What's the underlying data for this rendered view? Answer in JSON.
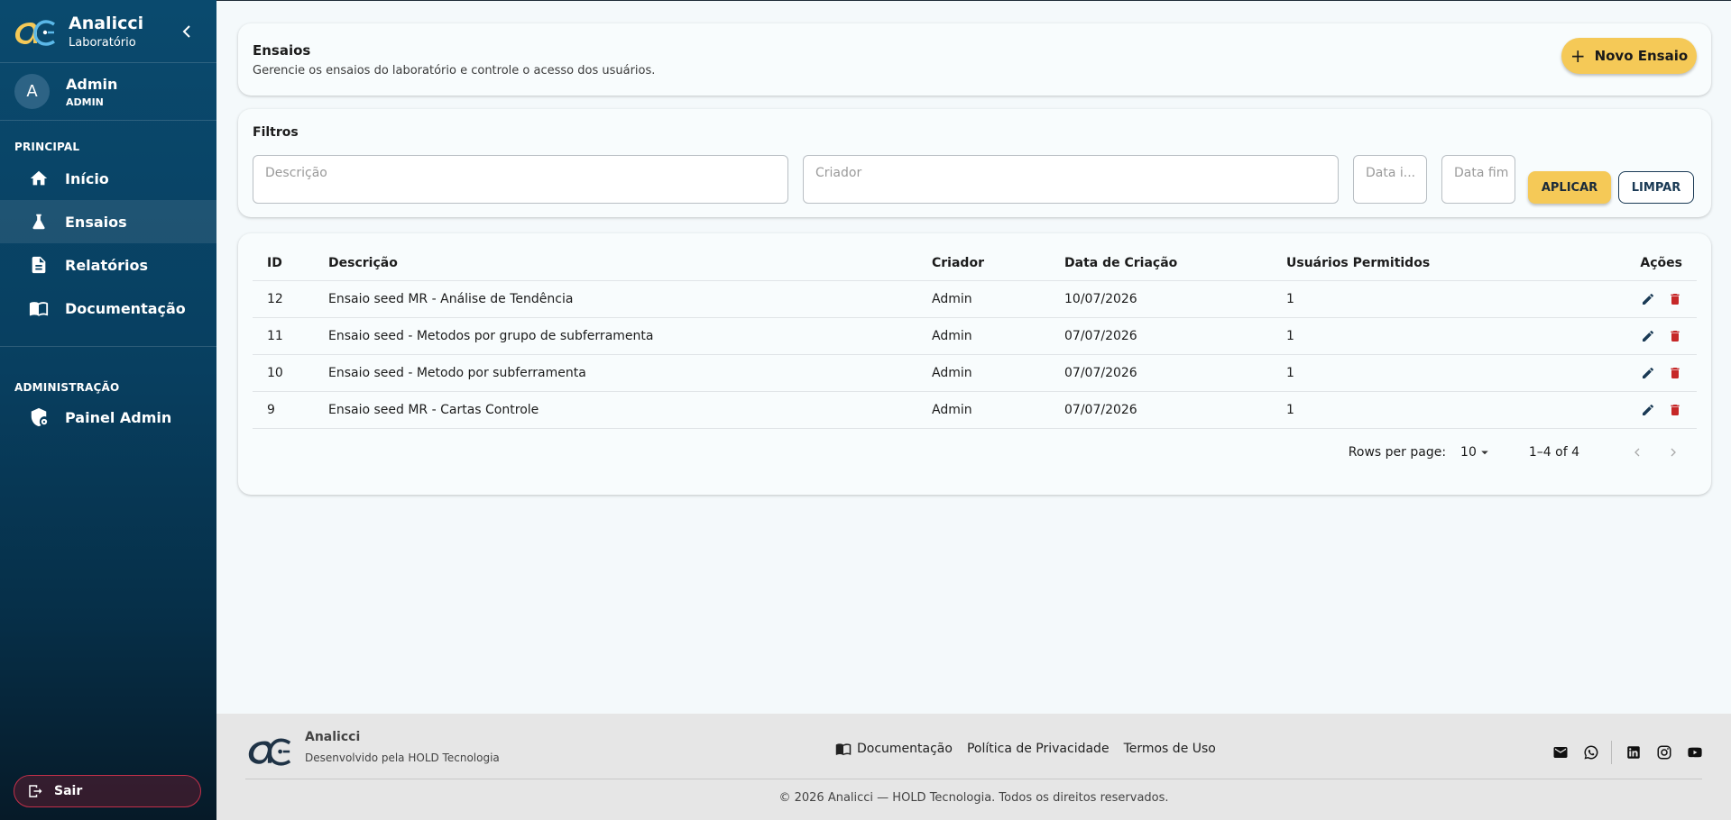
{
  "brand": {
    "name": "Analicci",
    "subtitle": "Laboratório"
  },
  "user": {
    "initial": "A",
    "name": "Admin",
    "role": "ADMIN"
  },
  "sidebar": {
    "sections": [
      {
        "label": "PRINCIPAL"
      },
      {
        "label": "ADMINISTRAÇÃO"
      }
    ],
    "items": [
      {
        "label": "Início",
        "icon": "home-icon"
      },
      {
        "label": "Ensaios",
        "icon": "flask-icon",
        "active": true
      },
      {
        "label": "Relatórios",
        "icon": "document-icon"
      },
      {
        "label": "Documentação",
        "icon": "book-icon"
      },
      {
        "label": "Painel Admin",
        "icon": "shield-gear-icon"
      }
    ],
    "logout": "Sair"
  },
  "header": {
    "title": "Ensaios",
    "subtitle": "Gerencie os ensaios do laboratório e controle o acesso dos usuários.",
    "new_button": "Novo Ensaio"
  },
  "filters": {
    "title": "Filtros",
    "descricao_placeholder": "Descrição",
    "criador_placeholder": "Criador",
    "data_inicio_placeholder": "Data i...",
    "data_fim_placeholder": "Data fim",
    "apply": "APLICAR",
    "clear": "LIMPAR"
  },
  "table": {
    "columns": [
      "ID",
      "Descrição",
      "Criador",
      "Data de Criação",
      "Usuários Permitidos",
      "Ações"
    ],
    "rows": [
      {
        "id": "12",
        "descricao": "Ensaio seed MR - Análise de Tendência",
        "criador": "Admin",
        "data": "10/07/2026",
        "usuarios": "1"
      },
      {
        "id": "11",
        "descricao": "Ensaio seed - Metodos por grupo de subferramenta",
        "criador": "Admin",
        "data": "07/07/2026",
        "usuarios": "1"
      },
      {
        "id": "10",
        "descricao": "Ensaio seed - Metodo por subferramenta",
        "criador": "Admin",
        "data": "07/07/2026",
        "usuarios": "1"
      },
      {
        "id": "9",
        "descricao": "Ensaio seed MR - Cartas Controle",
        "criador": "Admin",
        "data": "07/07/2026",
        "usuarios": "1"
      }
    ],
    "pagination": {
      "rows_per_page_label": "Rows per page:",
      "rows_per_page": "10",
      "range": "1–4 of 4"
    }
  },
  "footer": {
    "name": "Analicci",
    "developed_by": "Desenvolvido pela HOLD Tecnologia",
    "links": [
      "Documentação",
      "Política de Privacidade",
      "Termos de Uso"
    ],
    "copyright": "© 2026 Analicci — HOLD Tecnologia. Todos os direitos reservados."
  },
  "colors": {
    "sidebar": "#0a4a6e",
    "accent": "#f5c957",
    "delete": "#c62828",
    "edit": "#1a3a55"
  }
}
